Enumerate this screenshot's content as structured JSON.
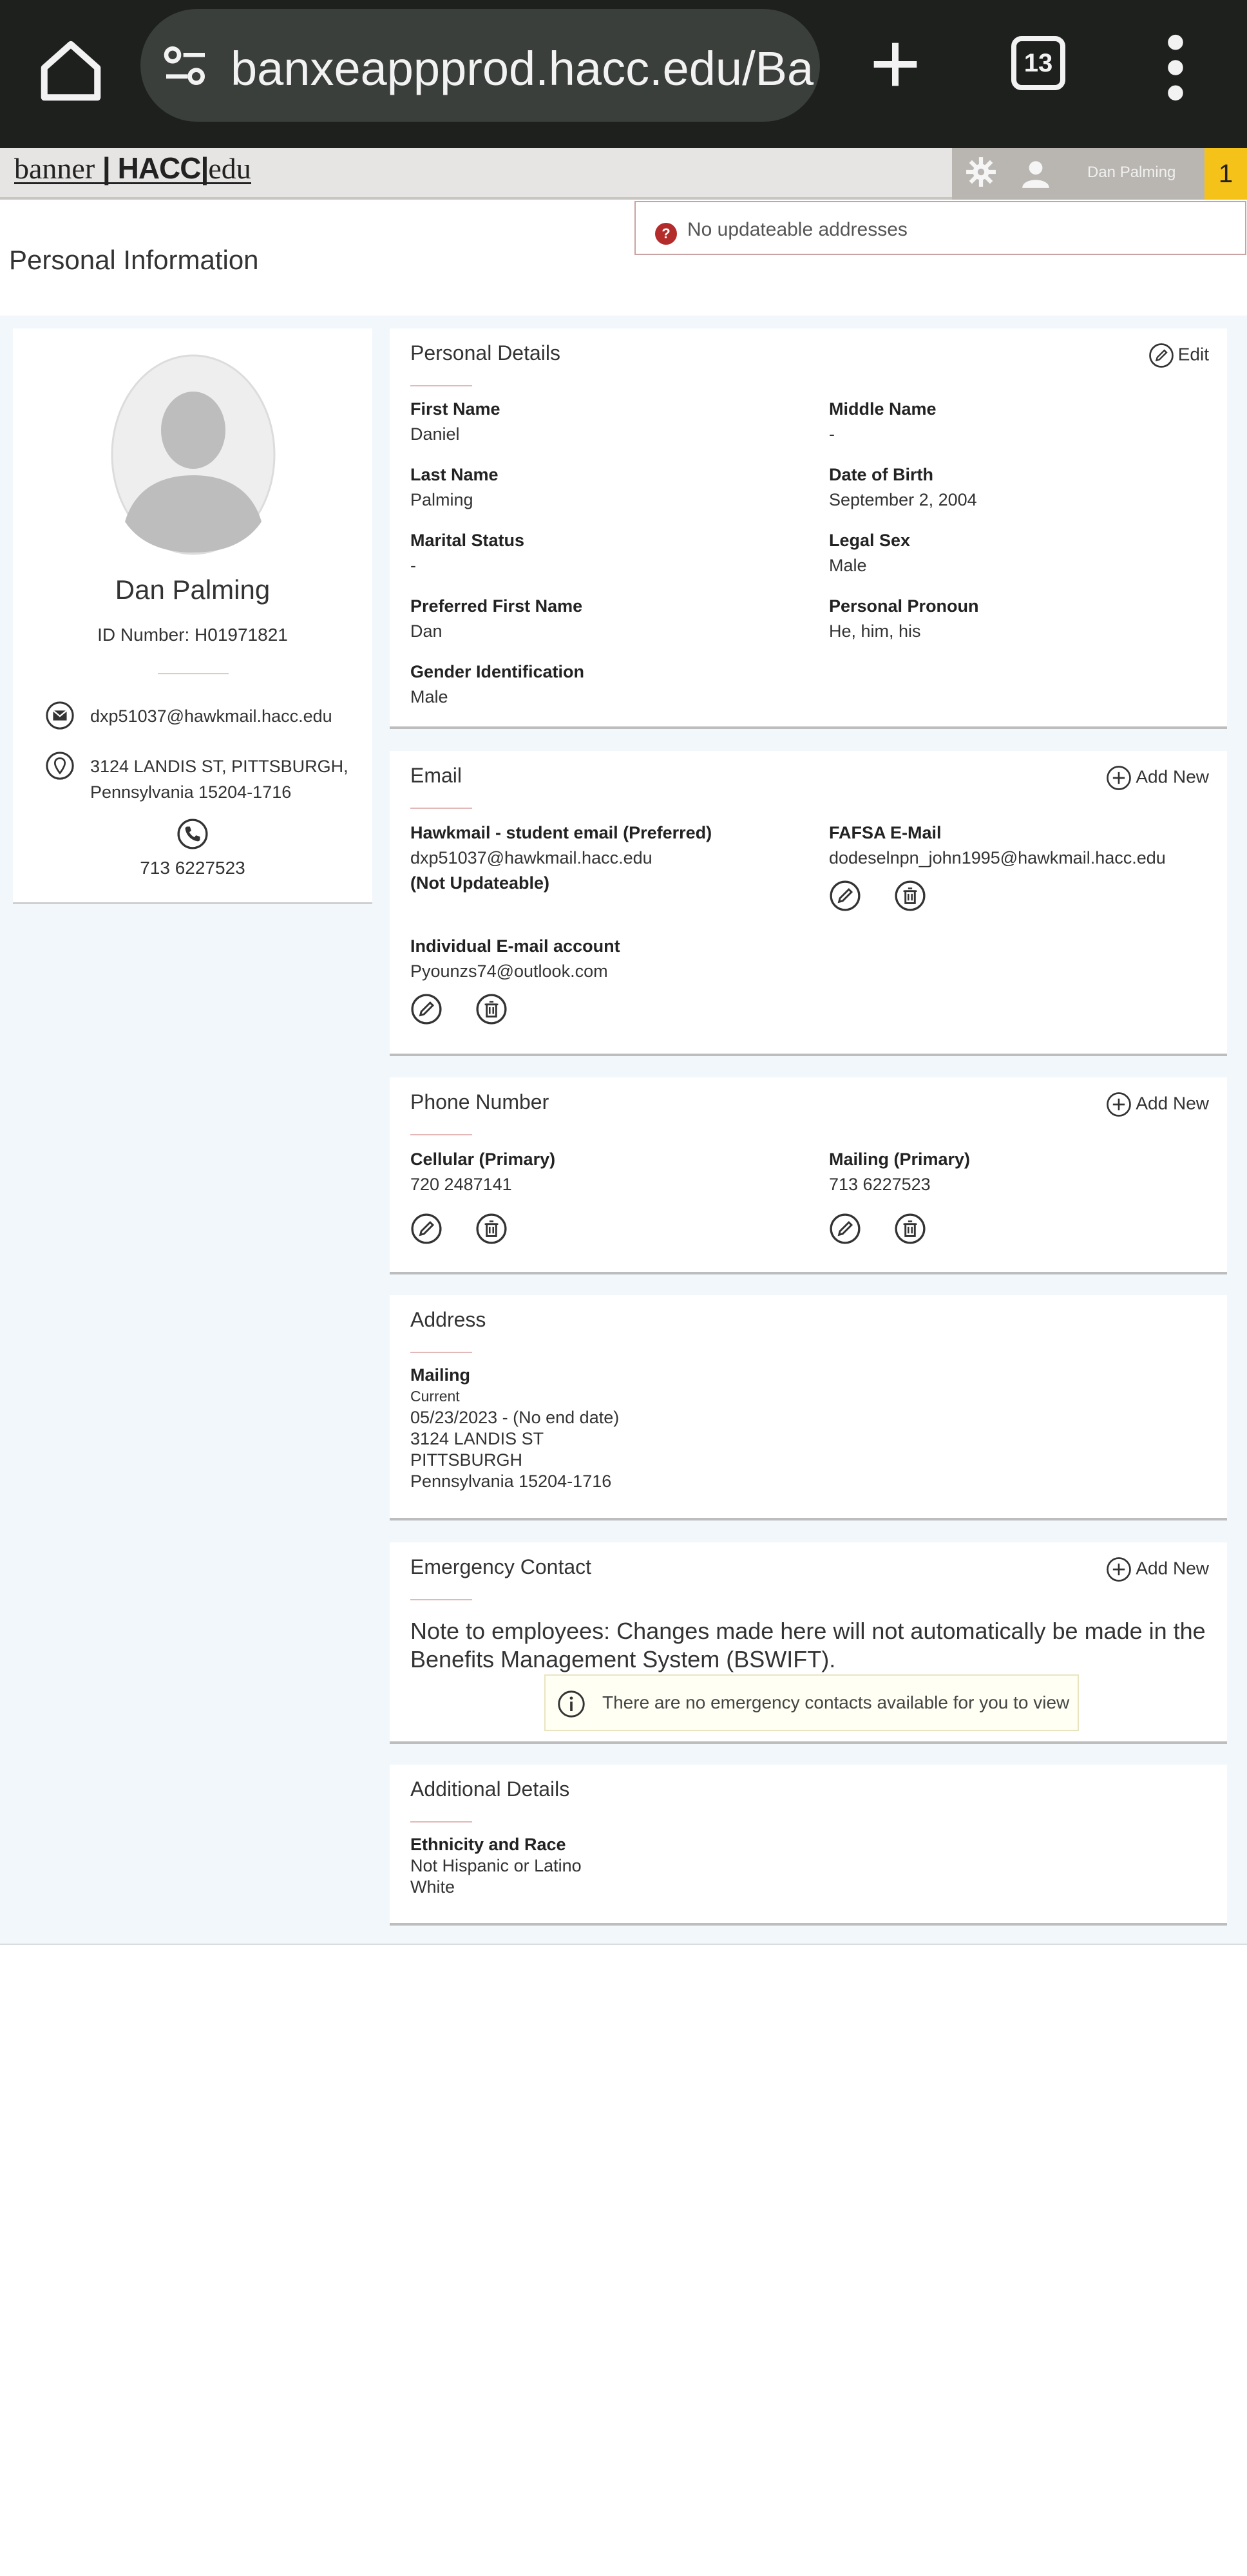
{
  "browser": {
    "url": "banxeappprod.hacc.edu/Ba",
    "tab_count": "13"
  },
  "header": {
    "logo_part1": "banner",
    "logo_part2": "HACC",
    "logo_part3": "edu",
    "user_name": "Dan Palming",
    "notification_count": "1"
  },
  "alert": {
    "message": "No updateable addresses"
  },
  "page": {
    "title": "Personal Information"
  },
  "profile": {
    "name": "Dan Palming",
    "id_number": "ID Number: H01971821",
    "email": "dxp51037@hawkmail.hacc.edu",
    "address_line1": "3124 LANDIS ST, PITTSBURGH,",
    "address_line2": "Pennsylvania 15204-1716",
    "phone": "713 6227523"
  },
  "personal_details": {
    "title": "Personal Details",
    "edit_label": "Edit",
    "first_name_label": "First Name",
    "first_name": "Daniel",
    "middle_name_label": "Middle Name",
    "middle_name": "-",
    "last_name_label": "Last Name",
    "last_name": "Palming",
    "dob_label": "Date of Birth",
    "dob": "September 2, 2004",
    "marital_label": "Marital Status",
    "marital": "-",
    "legal_sex_label": "Legal Sex",
    "legal_sex": "Male",
    "preferred_first_label": "Preferred First Name",
    "preferred_first": "Dan",
    "pronoun_label": "Personal Pronoun",
    "pronoun": "He, him, his",
    "gender_label": "Gender Identification",
    "gender": "Male"
  },
  "email_section": {
    "title": "Email",
    "add_label": "Add New",
    "hawkmail_label": "Hawkmail - student email (Preferred)",
    "hawkmail_value": "dxp51037@hawkmail.hacc.edu",
    "hawkmail_note": "(Not Updateable)",
    "fafsa_label": "FAFSA E-Mail",
    "fafsa_value": "dodeselnpn_john1995@hawkmail.hacc.edu",
    "individual_label": "Individual E-mail account",
    "individual_value": "Pyounzs74@outlook.com"
  },
  "phone_section": {
    "title": "Phone Number",
    "add_label": "Add New",
    "cell_label": "Cellular (Primary)",
    "cell_value": "720 2487141",
    "mailing_label": "Mailing (Primary)",
    "mailing_value": "713 6227523"
  },
  "address_section": {
    "title": "Address",
    "type": "Mailing",
    "status": "Current",
    "dates": "05/23/2023 - (No end date)",
    "line1": "3124 LANDIS ST",
    "line2": "PITTSBURGH",
    "line3": "Pennsylvania 15204-1716"
  },
  "emergency_section": {
    "title": "Emergency Contact",
    "add_label": "Add New",
    "note": "Note to employees: Changes made here will not automatically be made in the Benefits Management System (BSWIFT).",
    "info": "There are no emergency contacts available for you to view"
  },
  "additional_section": {
    "title": "Additional Details",
    "ethnicity_label": "Ethnicity and Race",
    "ethnicity_value1": "Not Hispanic or Latino",
    "ethnicity_value2": "White"
  },
  "colors": {
    "chrome_bg": "#1d201d",
    "url_bar": "#3a3f3b",
    "header_bg": "#e7e5e3",
    "notification": "#f5c21a",
    "alert_icon": "#b32b2b",
    "page_bg": "#f1f7fb"
  }
}
